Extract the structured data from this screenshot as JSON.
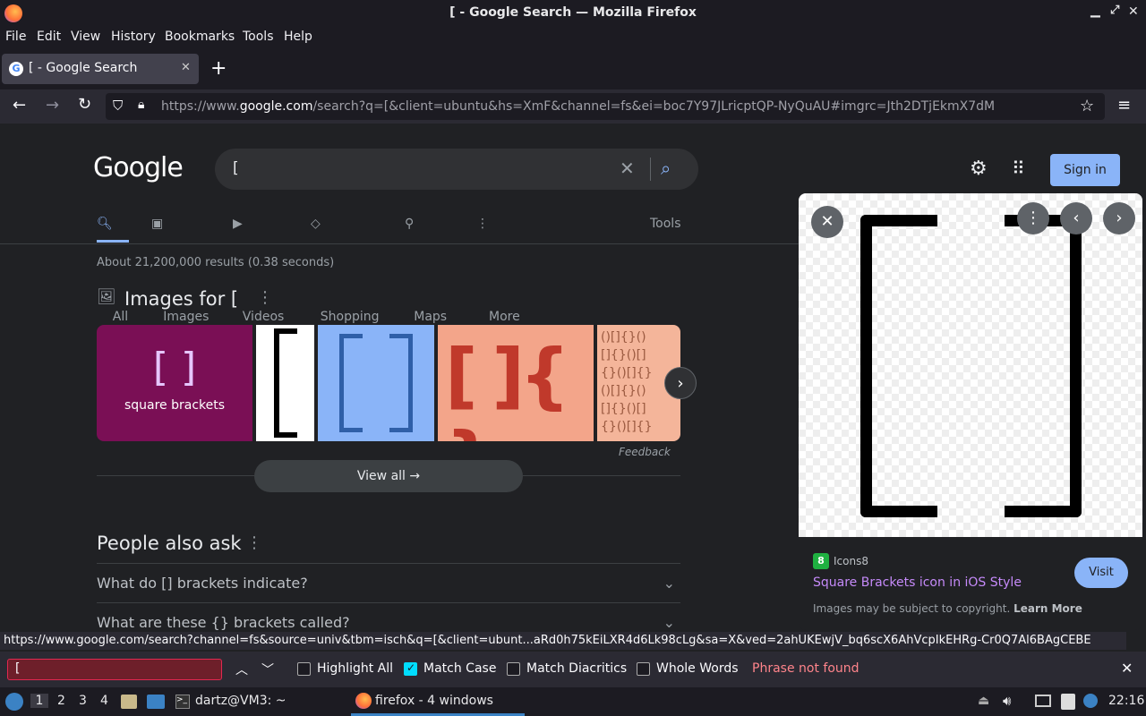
{
  "window": {
    "title": "[ - Google Search — Mozilla Firefox"
  },
  "menu": [
    "File",
    "Edit",
    "View",
    "History",
    "Bookmarks",
    "Tools",
    "Help"
  ],
  "tab": {
    "title": "[ - Google Search"
  },
  "address": {
    "prefix": "https://www.",
    "domain": "google.com",
    "rest": "/search?q=[&client=ubuntu&hs=XmF&channel=fs&ei=boc7Y97JLricptQP-NyQuAU#imgrc=Jth2DTjEkmX7dM"
  },
  "google": {
    "logo": "Google",
    "query": "[",
    "signin": "Sign in",
    "tabs": [
      "All",
      "Images",
      "Videos",
      "Shopping",
      "Maps",
      "More"
    ],
    "tools": "Tools",
    "stats": "About 21,200,000 results (0.38 seconds)",
    "images_heading": "Images for [",
    "tile1_brackets": "[ ]",
    "tile1_caption": "square brackets",
    "feedback": "Feedback",
    "view_all": "View all",
    "paa_heading": "People also ask",
    "paa": [
      "What do [] brackets indicate?",
      "What are these {} brackets called?"
    ]
  },
  "side": {
    "source": "Icons8",
    "title": "Square Brackets icon in iOS Style",
    "visit": "Visit",
    "copyright": "Images may be subject to copyright.",
    "learn_more": "Learn More"
  },
  "status_url": "https://www.google.com/search?channel=fs&source=univ&tbm=isch&q=[&client=ubunt...aRd0h75kEiLXR4d6Lk98cLg&sa=X&ved=2ahUKEwjV_bq6scX6AhVcpIkEHRg-Cr0Q7Al6BAgCEBE",
  "find": {
    "value": "[",
    "highlight_all": "Highlight All",
    "match_case": "Match Case",
    "match_diacritics": "Match Diacritics",
    "whole_words": "Whole Words",
    "status": "Phrase not found"
  },
  "taskbar": {
    "workspaces": [
      "1",
      "2",
      "3",
      "4"
    ],
    "terminal": "dartz@VM3: ~",
    "firefox": "firefox - 4 windows",
    "clock": "22:16"
  },
  "colors": {
    "signin": "#8ab4f8",
    "status_red": "#ff848b",
    "accent": "#00ddff"
  }
}
